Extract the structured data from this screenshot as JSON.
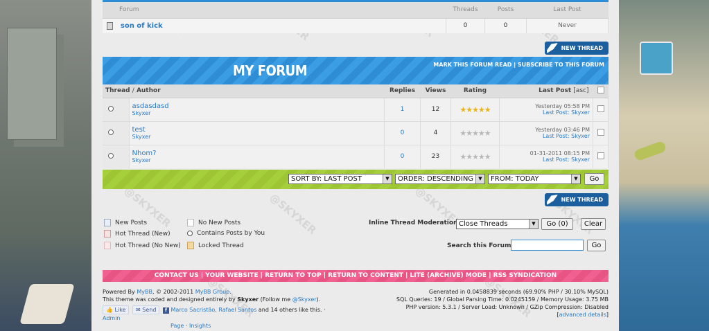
{
  "subforum_table": {
    "headers": {
      "forum": "Forum",
      "threads": "Threads",
      "posts": "Posts",
      "last_post": "Last Post"
    },
    "row": {
      "name": "son of kick",
      "threads": "0",
      "posts": "0",
      "last_post": "Never"
    }
  },
  "new_thread_label": "NEW THREAD",
  "forum_header": {
    "title": "MY FORUM",
    "mark_read": "MARK THIS FORUM READ",
    "separator": "|",
    "subscribe": "SUBSCRIBE TO THIS FORUM"
  },
  "thread_table": {
    "headers": {
      "thread": "Thread",
      "slash": "/",
      "author": "Author",
      "replies": "Replies",
      "views": "Views",
      "rating": "Rating",
      "last_post": "Last Post",
      "asc": "[asc]"
    },
    "rows": [
      {
        "title": "asdasdasd",
        "author": "Skyxer",
        "replies": "1",
        "views": "12",
        "rating": 5,
        "date": "Yesterday 05:58 PM",
        "last_post_label": "Last Post:",
        "last_post_author": "Skyxer"
      },
      {
        "title": "test",
        "author": "Skyxer",
        "replies": "0",
        "views": "4",
        "rating": 0,
        "date": "Yesterday 03:46 PM",
        "last_post_label": "Last Post:",
        "last_post_author": "Skyxer"
      },
      {
        "title": "Nhom?",
        "author": "Skyxer",
        "replies": "0",
        "views": "23",
        "rating": 0,
        "date": "01-31-2011 08:15 PM",
        "last_post_label": "Last Post:",
        "last_post_author": "Skyxer"
      }
    ]
  },
  "sort_bar": {
    "sort_by": "SORT BY: LAST POST",
    "order": "ORDER: DESCENDING",
    "from": "FROM: TODAY",
    "go": "Go"
  },
  "legend": {
    "new_posts": "New Posts",
    "no_new_posts": "No New Posts",
    "hot_thread_new": "Hot Thread (New)",
    "contains_posts": "Contains Posts by You",
    "hot_thread_no_new": "Hot Thread (No New)",
    "locked_thread": "Locked Thread"
  },
  "moderation": {
    "label": "Inline Thread Moderation:",
    "selected": "Close Threads",
    "go": "Go (0)",
    "clear": "Clear"
  },
  "search": {
    "label": "Search this Forum:",
    "value": "",
    "go": "Go"
  },
  "footer_links": {
    "contact": "CONTACT US",
    "website": "YOUR WEBSITE",
    "top": "RETURN TO TOP",
    "content": "RETURN TO CONTENT",
    "lite": "LITE (ARCHIVE) MODE",
    "rss": "RSS SYNDICATION",
    "separator": "|"
  },
  "credits": {
    "powered_by": "Powered By",
    "mybb": "MyBB",
    "copyright": ", © 2002-2011",
    "mybb_group": "MyBB Group",
    "period": ".",
    "theme_text": "This theme was coded and designed entirely by",
    "skyxer": "Skyxer",
    "follow_me": "(Follow me",
    "twitter": "@Skyxer",
    "close": ").",
    "like": "Like",
    "send": "Send",
    "fb_names": "Marco Sacristão, Rafael Santos",
    "fb_others": "and 14 others like this.",
    "fb_sep": "·",
    "admin": "Admin",
    "page": "Page",
    "insights": "Insights"
  },
  "stats": {
    "line1": "Generated in 0.0458839 seconds (69.90% PHP / 30.10% MySQL)",
    "line2": "SQL Queries: 19 / Global Parsing Time: 0.0245159 / Memory Usage: 3.75 MB",
    "line3": "PHP version: 5.3.1 / Server Load: Unknown / GZip Compression: Disabled",
    "advanced": "advanced details"
  },
  "colors": {
    "header_blue": "#3b9de3",
    "sort_bar_lime": "#a6cf3c",
    "footer_pink": "#f06191",
    "link_blue": "#2979c4",
    "star_gold": "#e8b417"
  }
}
